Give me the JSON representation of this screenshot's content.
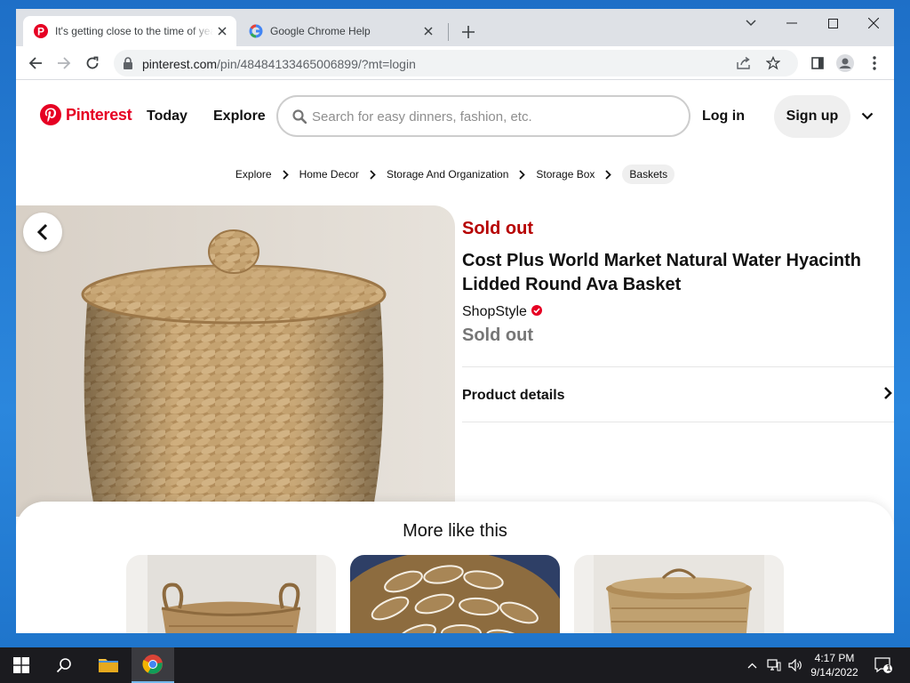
{
  "browser": {
    "tabs": [
      {
        "title": "It's getting close to the time of year",
        "active": true
      },
      {
        "title": "Google Chrome Help",
        "active": false
      }
    ],
    "url": {
      "host": "pinterest.com",
      "path": "/pin/48484133465006899/?mt=login"
    }
  },
  "header": {
    "logo": "Pinterest",
    "nav": [
      "Today",
      "Explore"
    ],
    "search_placeholder": "Search for easy dinners, fashion, etc.",
    "login": "Log in",
    "signup": "Sign up"
  },
  "breadcrumbs": [
    "Explore",
    "Home Decor",
    "Storage And Organization",
    "Storage Box",
    "Baskets"
  ],
  "pin": {
    "status": "Sold out",
    "title": "Cost Plus World Market Natural Water Hyacinth Lidded Round Ava Basket",
    "merchant": "ShopStyle",
    "price_status": "Sold out",
    "details_label": "Product details"
  },
  "more": {
    "title": "More like this"
  },
  "taskbar": {
    "time": "4:17 PM",
    "date": "9/14/2022",
    "notifications": "1"
  },
  "colors": {
    "brand": "#e60023",
    "sold": "#b60000"
  }
}
